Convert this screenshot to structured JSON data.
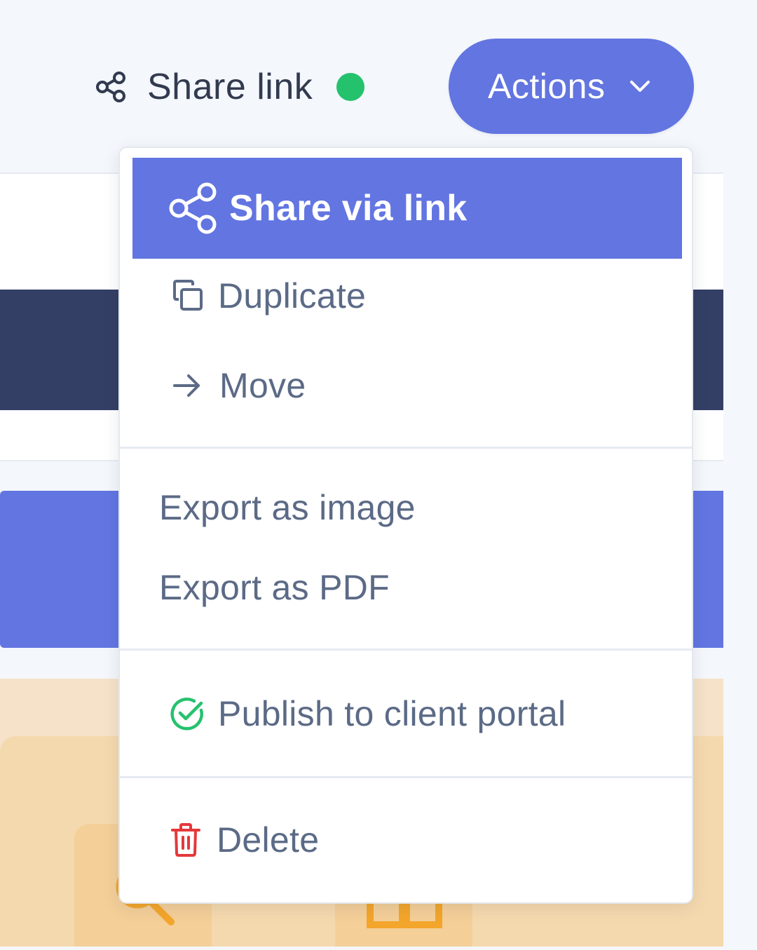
{
  "toolbar": {
    "share_link": {
      "label": "Share link",
      "icon": "share-icon",
      "status": "active",
      "status_color": "#25c26e"
    },
    "actions_button": {
      "label": "Actions",
      "icon": "chevron-down-icon",
      "color": "#6275e1",
      "expanded": true
    }
  },
  "dropdown": {
    "items": [
      {
        "id": "share-via-link",
        "label": "Share via link",
        "icon": "share-icon",
        "highlighted": true
      },
      {
        "id": "duplicate",
        "label": "Duplicate",
        "icon": "copy-icon"
      },
      {
        "id": "move",
        "label": "Move",
        "icon": "arrow-right-icon"
      },
      {
        "id": "export-image",
        "label": "Export as image",
        "icon": null
      },
      {
        "id": "export-pdf",
        "label": "Export as PDF",
        "icon": null
      },
      {
        "id": "publish",
        "label": "Publish to client portal",
        "icon": "check-circle-icon",
        "icon_color": "#25c26e"
      },
      {
        "id": "delete",
        "label": "Delete",
        "icon": "trash-icon",
        "icon_color": "#e5383b"
      }
    ],
    "highlight_color": "#6275e1",
    "text_color": "#5b6a86"
  },
  "background": {
    "colors": {
      "page": "#f4f7fb",
      "dark_bar": "#343f66",
      "blue_block": "#6275e1",
      "peach": "#f5d9ae"
    }
  }
}
